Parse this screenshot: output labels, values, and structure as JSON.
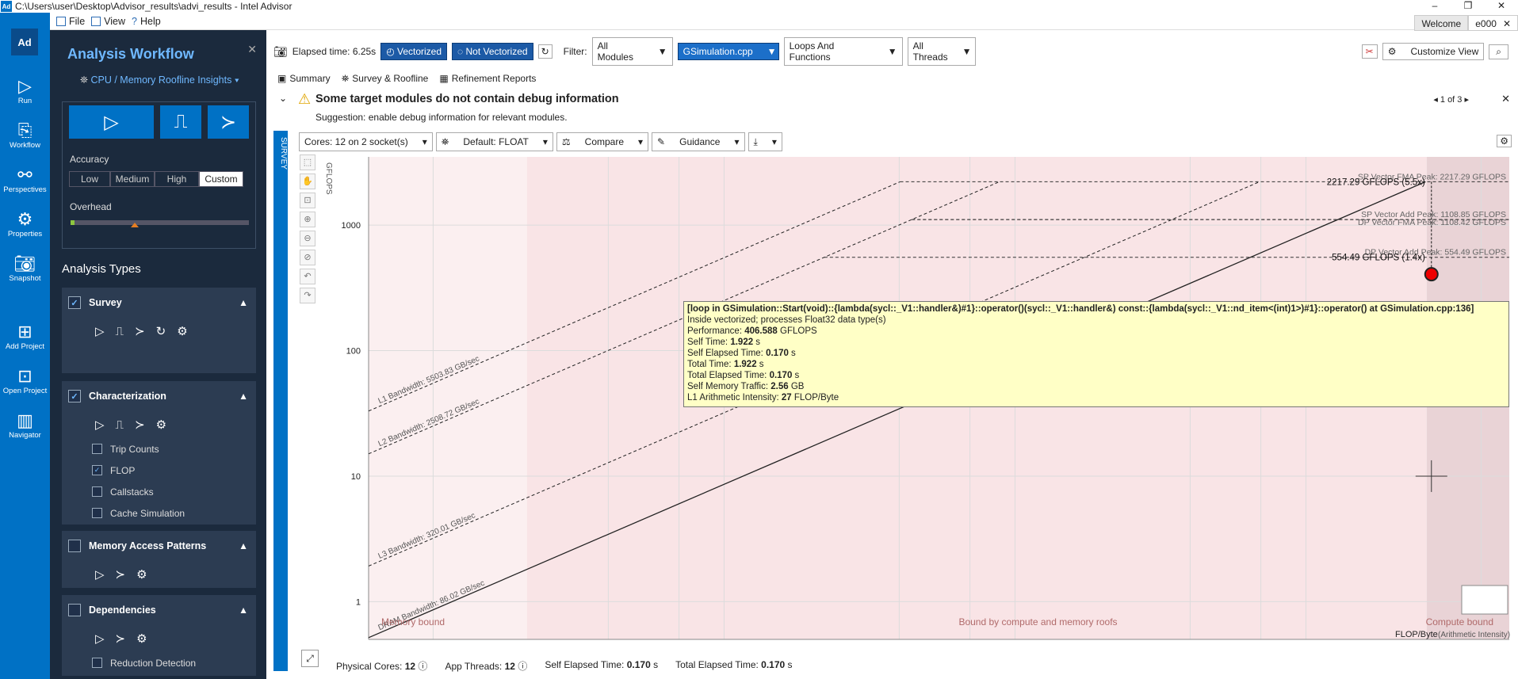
{
  "window": {
    "title": "C:\\Users\\user\\Desktop\\Advisor_results\\advi_results - Intel Advisor",
    "controls": [
      "–",
      "❐",
      "✕"
    ]
  },
  "menu": {
    "file": "File",
    "view": "View",
    "help": "Help"
  },
  "window_tabs": {
    "welcome": "Welcome",
    "result": "e000"
  },
  "leftbar": {
    "logo": "Ad",
    "run": "Run",
    "workflow": "Workflow",
    "perspectives": "Perspectives",
    "properties": "Properties",
    "snapshot": "Snapshot",
    "add_project": "Add Project",
    "open_project": "Open Project",
    "navigator": "Navigator"
  },
  "workflow": {
    "title": "Analysis Workflow",
    "mode": "CPU / Memory Roofline Insights",
    "accuracy_label": "Accuracy",
    "accuracy": [
      "Low",
      "Medium",
      "High",
      "Custom"
    ],
    "accuracy_selected": "Custom",
    "overhead_label": "Overhead",
    "analysis_types_title": "Analysis Types",
    "survey": "Survey",
    "characterization": "Characterization",
    "trip_counts": "Trip Counts",
    "flop": "FLOP",
    "callstacks": "Callstacks",
    "cache_sim": "Cache Simulation",
    "map": "Memory Access Patterns",
    "dependencies": "Dependencies",
    "reduction": "Reduction Detection"
  },
  "toolbar": {
    "elapsed": "Elapsed time: 6.25s",
    "vectorized": "Vectorized",
    "not_vectorized": "Not Vectorized",
    "filter": "Filter:",
    "modules": "All Modules",
    "source": "GSimulation.cpp",
    "loops": "Loops And Functions",
    "threads": "All Threads",
    "customize": "Customize View"
  },
  "tabs": {
    "summary": "Summary",
    "survey": "Survey & Roofline",
    "refinement": "Refinement Reports"
  },
  "warning": {
    "title": "Some target modules do not contain debug information",
    "suggestion": "Suggestion: enable debug information for relevant modules.",
    "nav": "1 of 3"
  },
  "chart_toolbar": {
    "cores": "Cores:  12 on 2 socket(s)",
    "default": "Default: FLOAT",
    "compare": "Compare",
    "guidance": "Guidance",
    "survey_strip": "SURVEY"
  },
  "chart_data": {
    "type": "scatter",
    "ylabel": "GFLOPS",
    "xlabel": "FLOP/Byte",
    "xlabel_suffix": "(Arithmetic Intensity)",
    "xscale": "log",
    "yscale": "log",
    "xlim": [
      0.006,
      50
    ],
    "ylim": [
      0.5,
      3500
    ],
    "xticks": [
      0.01,
      0.04,
      0.07,
      0.1,
      0.4,
      0.7,
      1,
      4,
      7,
      10,
      40
    ],
    "yticks": [
      1,
      10,
      100,
      1000
    ],
    "bandwidth_roofs": [
      {
        "name": "L1 Bandwidth: 5503.83 GB/sec",
        "bw": 5503.83,
        "style": "dashed"
      },
      {
        "name": "L2 Bandwidth: 2508.72 GB/sec",
        "bw": 2508.72,
        "style": "dashed"
      },
      {
        "name": "L3 Bandwidth: 320.01 GB/sec",
        "bw": 320.01,
        "style": "dashed"
      },
      {
        "name": "DRAM Bandwidth: 86.02 GB/sec",
        "bw": 86.02,
        "style": "solid"
      }
    ],
    "compute_roofs": [
      {
        "name": "SP Vector FMA Peak: 2217.29 GFLOPS",
        "value": 2217.29
      },
      {
        "name": "SP Vector Add Peak: 1108.85 GFLOPS",
        "value": 1108.85
      },
      {
        "name": "DP Vector FMA Peak: 1108.42 GFLOPS",
        "value": 1108.42
      },
      {
        "name": "DP Vector Add Peak: 554.49 GFLOPS",
        "value": 554.49
      }
    ],
    "roof_callouts": [
      "2217.29 GFLOPS (5.5x)",
      "554.49 GFLOPS (1.4x)"
    ],
    "point": {
      "ai": 27,
      "gflops": 406.588
    },
    "zones": [
      "Memory bound",
      "Bound by compute and memory roofs",
      "Compute bound"
    ]
  },
  "tooltip": {
    "line1": "[loop in GSimulation::Start(void)::{lambda(sycl::_V1::handler&)#1}::operator()(sycl::_V1::handler&) const::{lambda(sycl::_V1::nd_item<(int)1>)#1}::operator() at GSimulation.cpp:136]",
    "line2": "Inside vectorized; processes Float32 data type(s)",
    "perf_label": "Performance: ",
    "perf": "406.588",
    "perf_unit": " GFLOPS",
    "self_time_label": "Self Time: ",
    "self_time": "1.922",
    "s": " s",
    "self_elapsed_label": "Self Elapsed Time: ",
    "self_elapsed": "0.170",
    "total_time_label": "Total Time: ",
    "total_time": "1.922",
    "total_elapsed_label": "Total Elapsed Time: ",
    "total_elapsed": "0.170",
    "traffic_label": "Self Memory Traffic: ",
    "traffic": "2.56",
    "traffic_unit": " GB",
    "ai_label": "L1 Arithmetic Intensity: ",
    "ai": "27",
    "ai_unit": " FLOP/Byte"
  },
  "status": {
    "phys_label": "Physical Cores:",
    "phys": "12",
    "threads_label": "App Threads:",
    "threads": "12",
    "self_label": "Self Elapsed Time:",
    "self": "0.170",
    "total_label": "Total Elapsed Time:",
    "total": "0.170",
    "unit": "s"
  }
}
